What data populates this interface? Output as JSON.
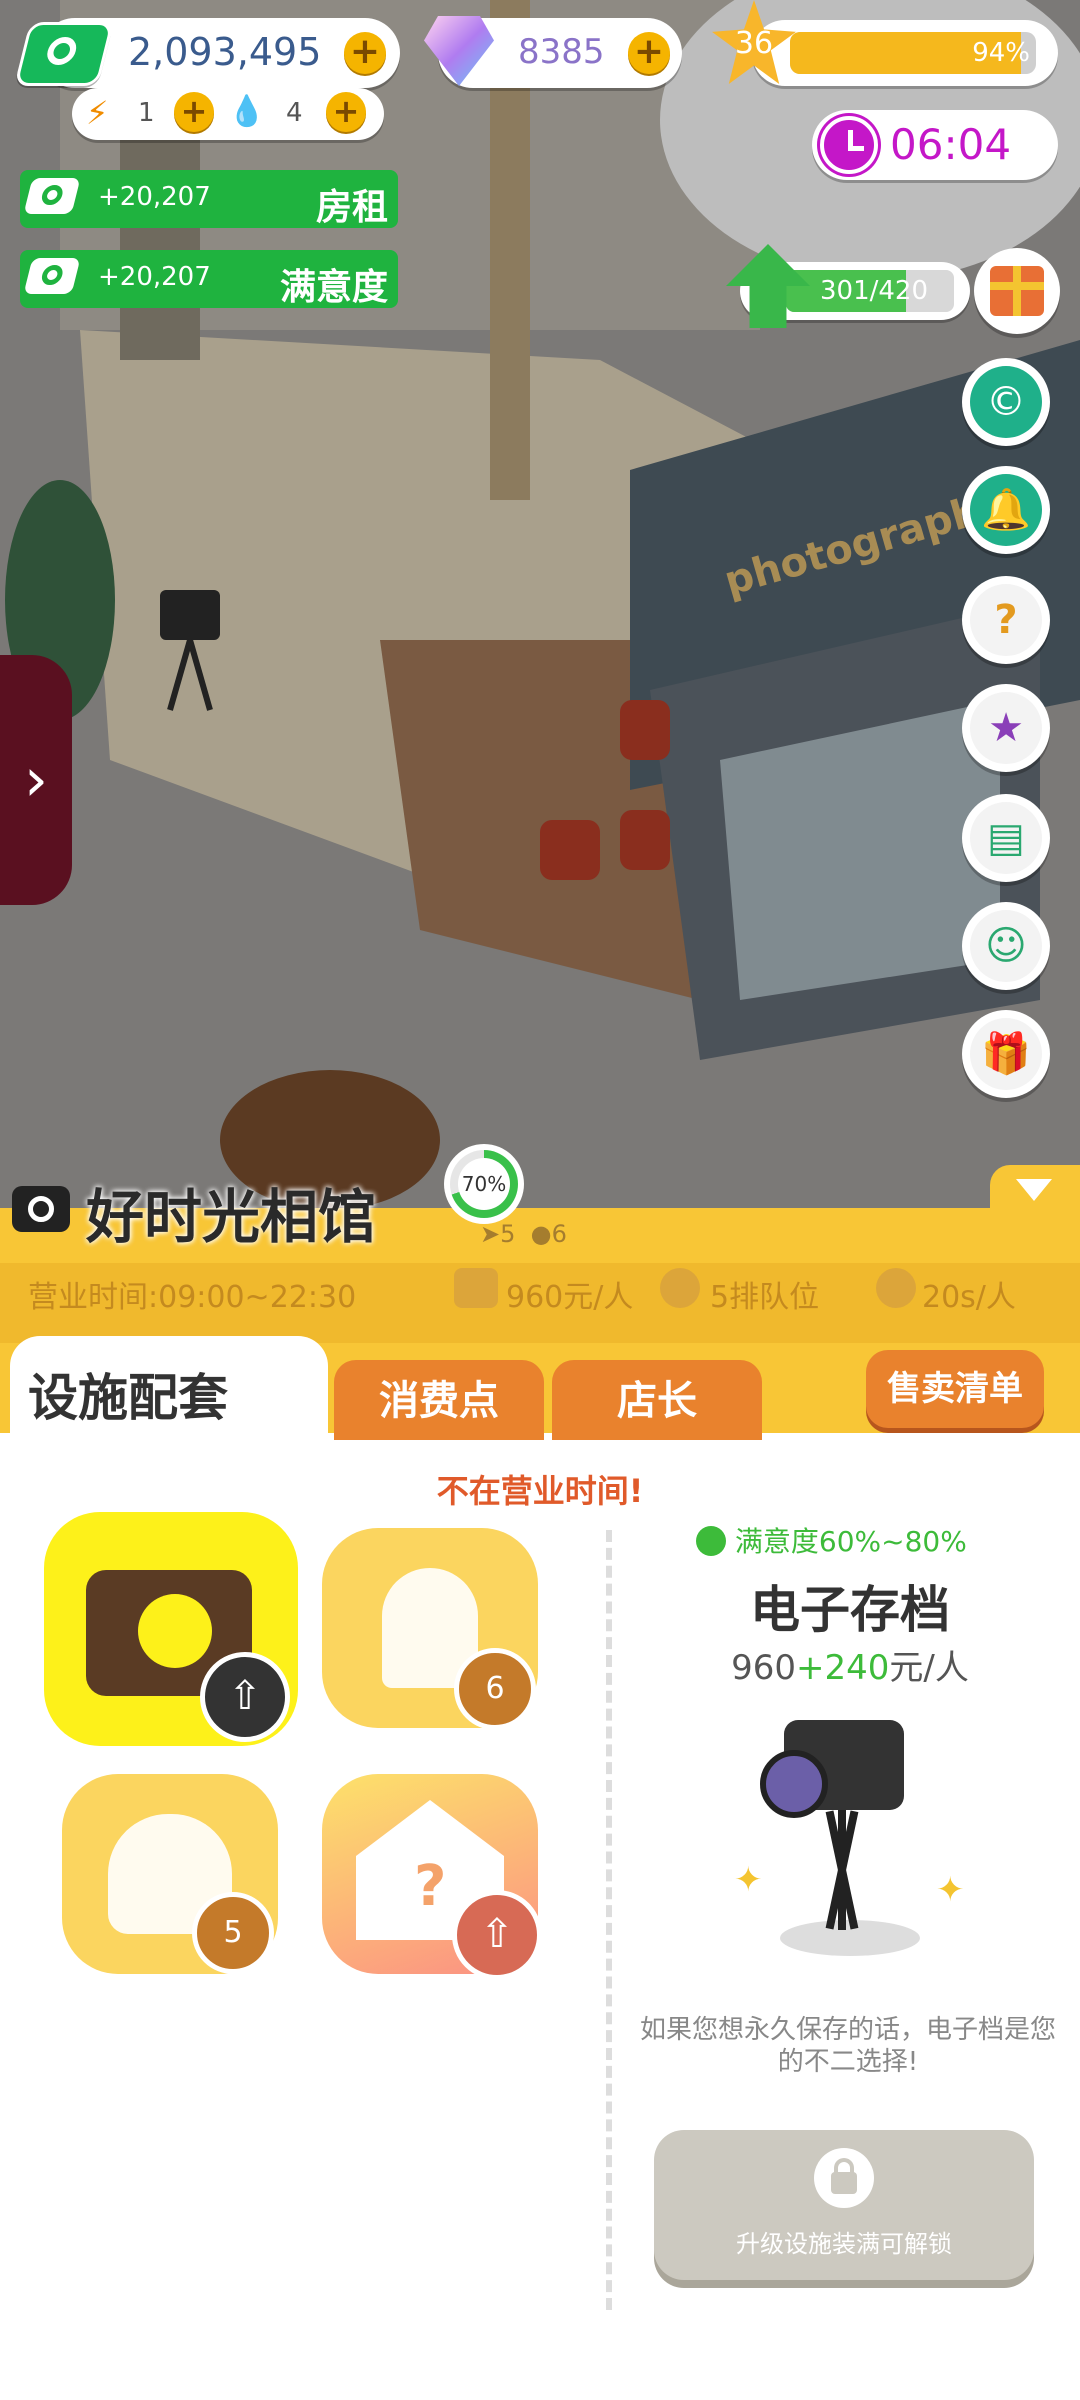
{
  "currency": {
    "money": "2,093,495",
    "gems": "8385",
    "energy": "1",
    "water": "4"
  },
  "level": {
    "value": "36",
    "exp_text": "94%",
    "exp_fraction": 0.94
  },
  "timer": "06:04",
  "income_bars": [
    {
      "value": "+20,207",
      "label": "房租"
    },
    {
      "value": "+20,207",
      "label": "满意度"
    }
  ],
  "upgrade": {
    "progress_text": "301/420",
    "fraction": 0.717
  },
  "scene": {
    "sign_text": "photography"
  },
  "side_buttons": [
    "coupon-icon",
    "bell-icon",
    "mystery-box-icon",
    "star-book-icon",
    "notebook-icon",
    "ghost-chat-icon",
    "gift-icon"
  ],
  "shop": {
    "name": "好时光相馆",
    "progress": "70%",
    "progress_fraction": 0.7,
    "small_stats": [
      "5",
      "6"
    ],
    "hours": "营业时间:09:00~22:30",
    "price": "960元/人",
    "queue": "5排队位",
    "duration": "20s/人"
  },
  "tabs": [
    "设施配套",
    "消费点",
    "店长"
  ],
  "sell_list_label": "售卖清单",
  "notice": "不在营业时间!",
  "facilities": [
    {
      "icon": "camera-smile-icon",
      "badge": ""
    },
    {
      "icon": "staff-clock-icon",
      "badge": "6"
    },
    {
      "icon": "customer-icon",
      "badge": "5"
    },
    {
      "icon": "house-question-icon",
      "badge": ""
    }
  ],
  "detail": {
    "satisfaction": "满意度60%~80%",
    "title": "电子存档",
    "price_base": "960",
    "price_bonus": "+240",
    "price_unit": "元/人",
    "description": "如果您想永久保存的话，电子档是您的不二选择!",
    "unlock_label": "升级设施装满可解锁"
  }
}
